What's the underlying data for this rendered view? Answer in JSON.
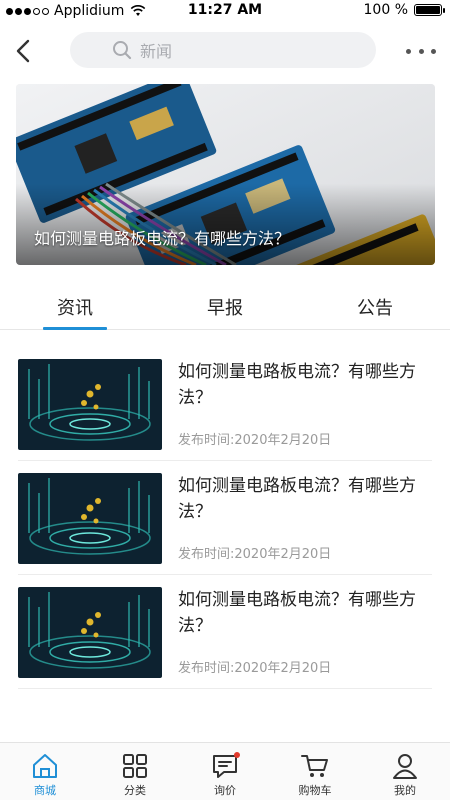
{
  "status_bar": {
    "carrier": "Applidium",
    "time": "11:27 AM",
    "battery": "100 %"
  },
  "header": {
    "search_placeholder": "新闻"
  },
  "banner": {
    "caption": "如何测量电路板电流？有哪些方法？"
  },
  "tabs": [
    {
      "label": "资讯",
      "active": true
    },
    {
      "label": "早报",
      "active": false
    },
    {
      "label": "公告",
      "active": false
    }
  ],
  "news": [
    {
      "title": "如何测量电路板电流？有哪些方法？",
      "date": "发布时间:2020年2月20日"
    },
    {
      "title": "如何测量电路板电流？有哪些方法？",
      "date": "发布时间:2020年2月20日"
    },
    {
      "title": "如何测量电路板电流？有哪些方法？",
      "date": "发布时间:2020年2月20日"
    }
  ],
  "bottom_nav": [
    {
      "label": "商城",
      "icon": "home-icon",
      "active": true
    },
    {
      "label": "分类",
      "icon": "grid-icon",
      "active": false
    },
    {
      "label": "询价",
      "icon": "message-icon",
      "active": false,
      "badge_dot": true
    },
    {
      "label": "购物车",
      "icon": "cart-icon",
      "active": false
    },
    {
      "label": "我的",
      "icon": "user-icon",
      "active": false
    }
  ],
  "colors": {
    "accent": "#1f8fd6",
    "badge": "#e23a2c",
    "search_bg": "#f0f1f3"
  }
}
